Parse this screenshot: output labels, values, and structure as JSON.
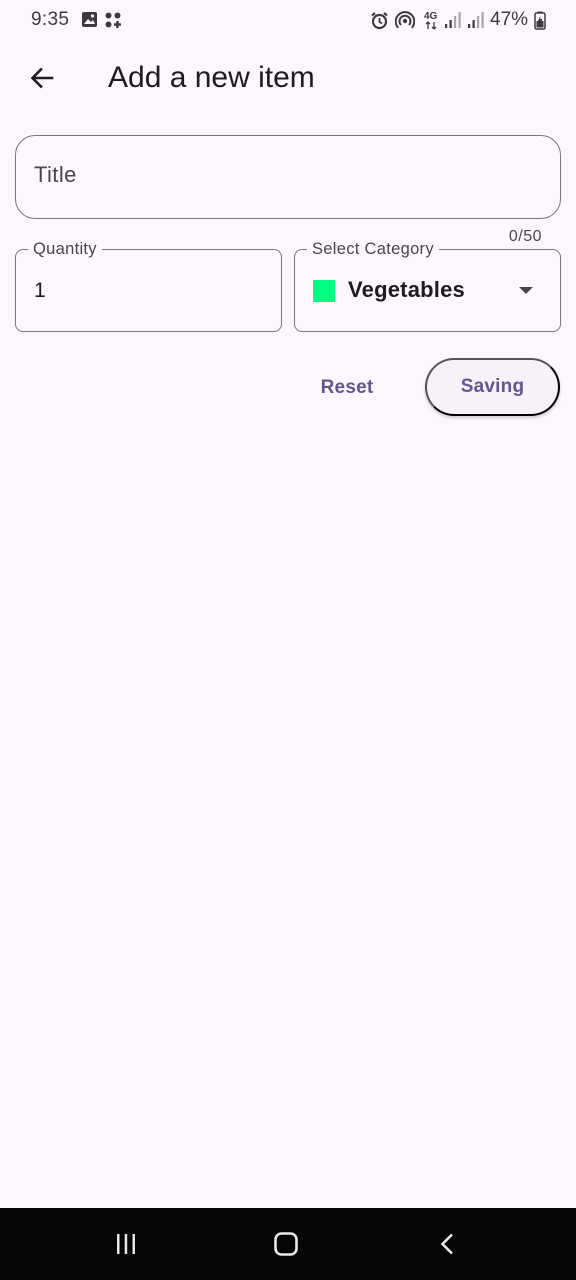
{
  "status_bar": {
    "time": "9:35",
    "battery": "47%",
    "icons": [
      "image-icon",
      "apps-icon",
      "alarm-icon",
      "hotspot-icon",
      "4g-icon",
      "signal-icon",
      "signal-icon",
      "battery-icon"
    ]
  },
  "app_bar": {
    "back_icon": "arrow-left-icon",
    "title": "Add a new item"
  },
  "form": {
    "title_field": {
      "label": "Title",
      "value": "",
      "counter": "0/50"
    },
    "quantity_field": {
      "label": "Quantity",
      "value": "1"
    },
    "category_field": {
      "label": "Select Category",
      "selected": "Vegetables",
      "swatch_color": "#00ff80"
    }
  },
  "actions": {
    "reset_label": "Reset",
    "save_label": "Saving"
  },
  "colors": {
    "background": "#fdf7fd",
    "accent": "#65558f",
    "outline": "#7a757f"
  },
  "nav_bar": {
    "icons": [
      "recents-icon",
      "home-icon",
      "back-icon"
    ]
  }
}
